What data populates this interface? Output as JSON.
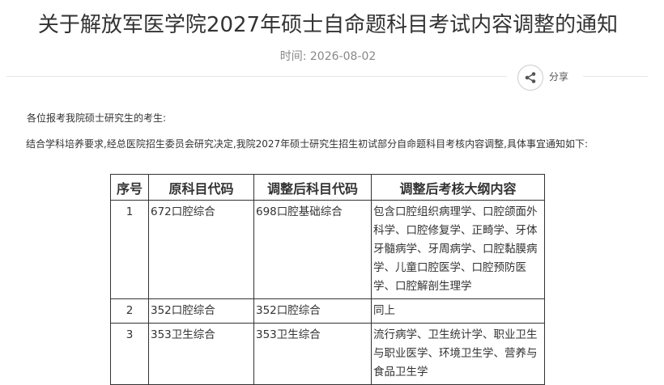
{
  "article": {
    "title": "关于解放军医学院2027年硕士自命题科目考试内容调整的通知",
    "time_label": "时间:",
    "time_value": "2026-08-02",
    "share_label": "分享",
    "greeting": "各位报考我院硕士研究生的考生:",
    "paragraph": "结合学科培养要求,经总医院招生委员会研究决定,我院2027年硕士研究生招生初试部分自命题科目考核内容调整,具体事宜通知如下:"
  },
  "table": {
    "headers": [
      "序号",
      "原科目代码",
      "调整后科目代码",
      "调整后考核大纲内容"
    ],
    "rows": [
      {
        "no": "1",
        "original": "672口腔综合",
        "adjusted": "698口腔基础综合",
        "outline": "包含口腔组织病理学、口腔颌面外科学、口腔修复学、正畸学、牙体牙髓病学、牙周病学、口腔黏膜病学、儿童口腔医学、口腔预防医学、口腔解剖生理学"
      },
      {
        "no": "2",
        "original": "352口腔综合",
        "adjusted": "352口腔综合",
        "outline": "同上"
      },
      {
        "no": "3",
        "original": "353卫生综合",
        "adjusted": "353卫生综合",
        "outline": "流行病学、卫生统计学、职业卫生与职业医学、环境卫生学、营养与食品卫生学"
      }
    ]
  },
  "icons": {
    "share": "share-icon"
  },
  "colors": {
    "text": "#333333",
    "muted": "#888888",
    "border": "#333333",
    "divider": "#e6e6e6"
  }
}
